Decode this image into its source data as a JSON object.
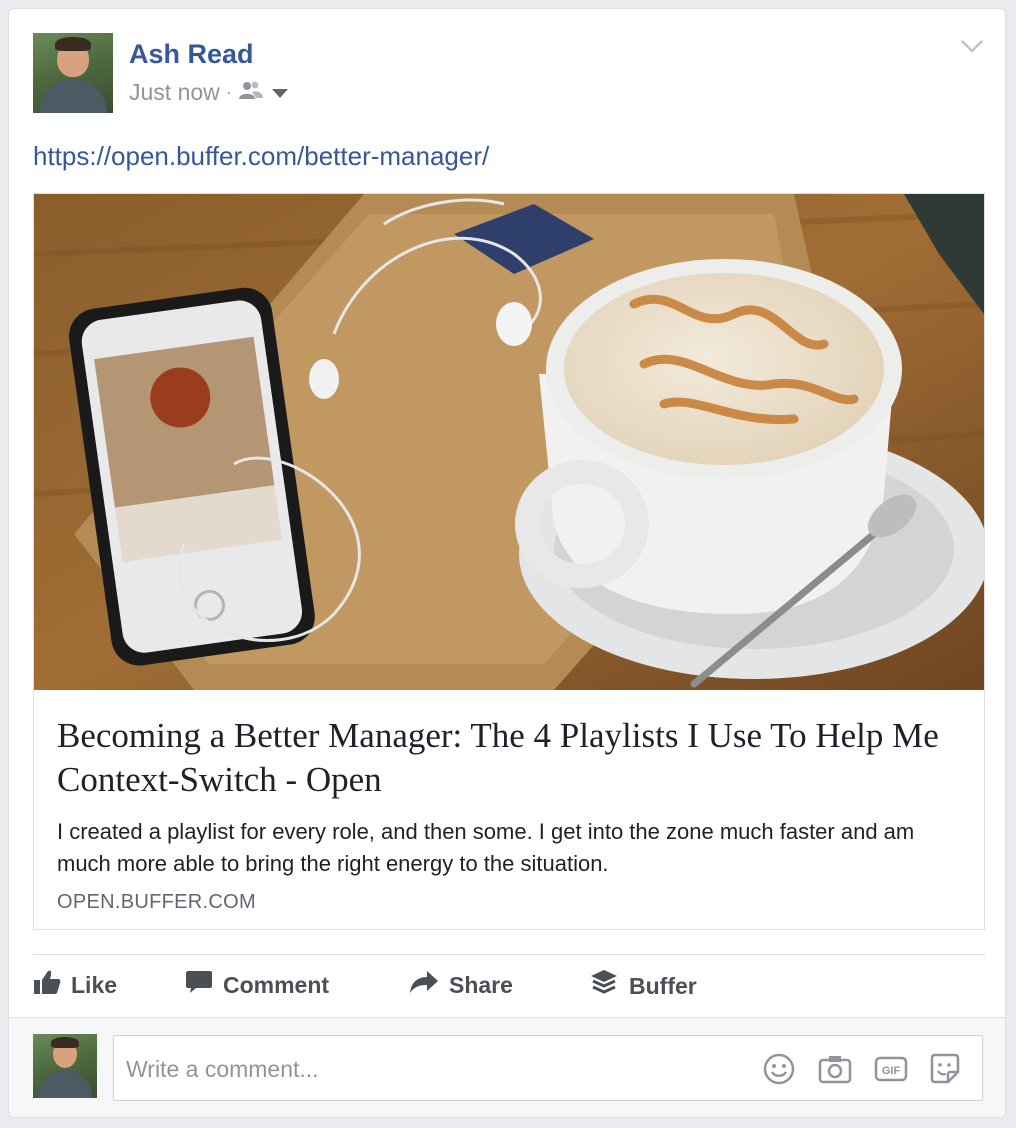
{
  "post": {
    "author": "Ash Read",
    "timestamp": "Just now",
    "separator": "·",
    "audience_icon": "friends-icon",
    "menu_icon": "chevron-down-icon",
    "link_url": "https://open.buffer.com/better-manager/"
  },
  "attachment": {
    "title": "Becoming a Better Manager: The 4 Playlists I Use To Help Me Context-Switch - Open",
    "description": "I created a playlist for every role, and then some. I get into the zone much faster and am much more able to bring the right energy to the situation.",
    "domain": "OPEN.BUFFER.COM"
  },
  "actions": {
    "like": "Like",
    "comment": "Comment",
    "share": "Share",
    "buffer": "Buffer"
  },
  "comment_box": {
    "placeholder": "Write a comment...",
    "gif_label": "GIF",
    "tools": [
      "emoji-icon",
      "camera-icon",
      "gif-icon",
      "sticker-icon"
    ]
  },
  "colors": {
    "author_blue": "#365899",
    "muted": "#90949c",
    "action_text": "#4b4f56"
  }
}
